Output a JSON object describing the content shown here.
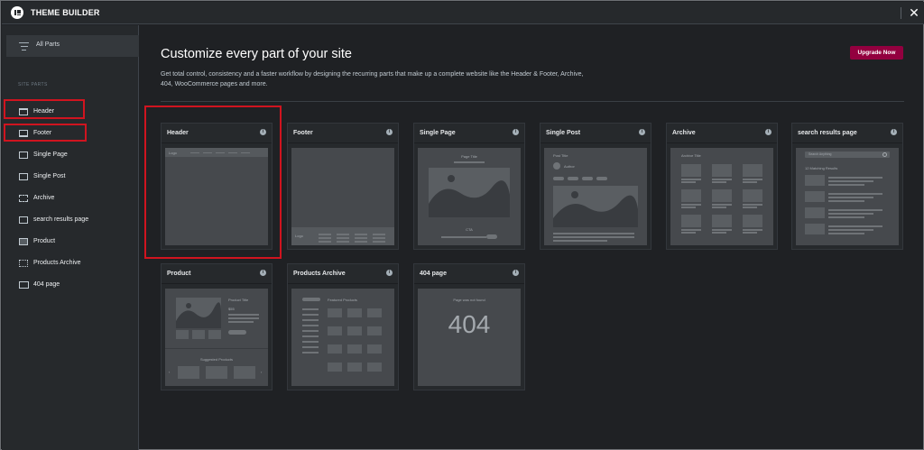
{
  "app": {
    "title": "THEME BUILDER"
  },
  "sidebar": {
    "all_parts_label": "All Parts",
    "section_heading": "SITE PARTS",
    "items": [
      {
        "label": "Header",
        "icon": "header-icon"
      },
      {
        "label": "Footer",
        "icon": "footer-icon"
      },
      {
        "label": "Single Page",
        "icon": "single-page-icon"
      },
      {
        "label": "Single Post",
        "icon": "single-post-icon"
      },
      {
        "label": "Archive",
        "icon": "archive-icon"
      },
      {
        "label": "search results page",
        "icon": "search-results-icon"
      },
      {
        "label": "Product",
        "icon": "product-icon"
      },
      {
        "label": "Products Archive",
        "icon": "products-archive-icon"
      },
      {
        "label": "404 page",
        "icon": "404-icon"
      }
    ]
  },
  "main": {
    "title": "Customize every part of your site",
    "description": "Get total control, consistency and a faster workflow by designing the recurring parts that make up a complete website like the Header & Footer, Archive, 404, WooCommerce pages and more.",
    "upgrade_label": "Upgrade Now",
    "cards": [
      {
        "title": "Header",
        "thumb_logo": "Logo"
      },
      {
        "title": "Footer",
        "thumb_logo": "Logo"
      },
      {
        "title": "Single Page",
        "thumb_title": "Page Title",
        "thumb_cta": "CTA"
      },
      {
        "title": "Single Post",
        "thumb_title": "Post Title",
        "thumb_author": "Author"
      },
      {
        "title": "Archive",
        "thumb_title": "Archive Title"
      },
      {
        "title": "search results page",
        "thumb_search": "Search Anything",
        "thumb_results": "12 Matching Results"
      },
      {
        "title": "Product",
        "thumb_title": "Product Title",
        "thumb_price": "$55",
        "thumb_suggested": "Suggested Products"
      },
      {
        "title": "Products Archive",
        "thumb_title": "Featured Products"
      },
      {
        "title": "404 page",
        "thumb_title": "Page was not found",
        "thumb_code": "404"
      }
    ]
  },
  "colors": {
    "accent": "#93003f",
    "highlight": "#d0141f",
    "background": "#1f2124",
    "panel": "#26292c"
  }
}
